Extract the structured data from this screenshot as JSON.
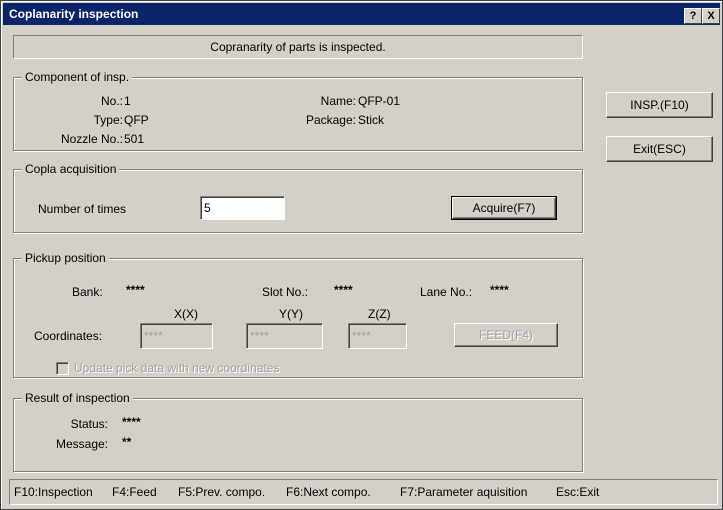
{
  "window": {
    "title": "Coplanarity inspection",
    "help_button": "?",
    "close_button": "X"
  },
  "banner": "Copranarity of parts is inspected.",
  "component": {
    "group_title": "Component of insp.",
    "no_label": "No.:",
    "no_value": "1",
    "type_label": "Type:",
    "type_value": "QFP",
    "nozzle_label": "Nozzle No.:",
    "nozzle_value": "501",
    "name_label": "Name:",
    "name_value": "QFP-01",
    "package_label": "Package:",
    "package_value": "Stick"
  },
  "acquisition": {
    "group_title": "Copla acquisition",
    "times_label": "Number of times",
    "times_value": "5",
    "acquire_button": "Acquire(F7)"
  },
  "pickup": {
    "group_title": "Pickup position",
    "bank_label": "Bank:",
    "bank_value": "****",
    "slot_label": "Slot No.:",
    "slot_value": "****",
    "lane_label": "Lane No.:",
    "lane_value": "****",
    "x_header": "X(X)",
    "y_header": "Y(Y)",
    "z_header": "Z(Z)",
    "coords_label": "Coordinates:",
    "x_value": "****",
    "y_value": "****",
    "z_value": "****",
    "feed_button": "FEED(F4)",
    "update_checkbox_label": "Update pick data with new coordinates"
  },
  "result": {
    "group_title": "Result of inspection",
    "status_label": "Status:",
    "status_value": "****",
    "message_label": "Message:",
    "message_value": "**"
  },
  "side_buttons": {
    "insp": "INSP.(F10)",
    "exit": "Exit(ESC)"
  },
  "statusbar": {
    "items": [
      "F10:Inspection",
      "F4:Feed",
      "F5:Prev. compo.",
      "F6:Next compo.",
      "F7:Parameter aquisition",
      "Esc:Exit"
    ]
  }
}
